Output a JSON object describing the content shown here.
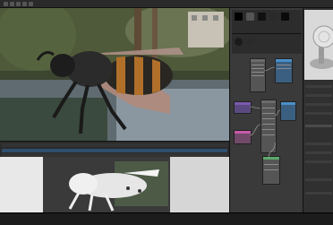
{
  "window": {
    "title": ""
  },
  "viewport": {
    "subject": "bee-model",
    "colors": {
      "bee_body": "#222222",
      "bee_stripe": "#b0702a",
      "wing": "#b08a7a",
      "background_tree": "#4d5838",
      "water": "#6f7f8d"
    }
  },
  "timeline": {
    "frame_label": "",
    "tracks": [
      "",
      "",
      ""
    ]
  },
  "bottom_viewport": {
    "subject": "bee-clay-render"
  },
  "node_editor": {
    "material_swatches": [
      "#000000",
      "#5a5a5a",
      "#111111",
      "#2a2a2a",
      "#0a0a0a",
      "#cccccc"
    ],
    "nodes": [
      {
        "header_color": "#6b6b6b",
        "accent": "#4a90c8"
      },
      {
        "header_color": "#6b6b6b",
        "accent": "#7a5ab0"
      },
      {
        "header_color": "#6b6b6b",
        "accent": "#c85aa8"
      },
      {
        "header_color": "#6b6b6b",
        "accent": "#4a90c8"
      },
      {
        "header_color": "#6b6b6b",
        "accent": "#5aa86b"
      },
      {
        "header_color": "#6b6b6b",
        "accent": "#4a90c8"
      }
    ]
  },
  "properties": {
    "preview_subject": "material-sphere-on-stand",
    "rows": [
      "",
      "",
      "",
      "",
      "",
      "",
      "",
      "",
      "",
      "",
      "",
      ""
    ]
  },
  "colors": {
    "panel_bg": "#3a3a3a",
    "dark_bg": "#222222",
    "accent_orange": "#d08020",
    "accent_blue": "#3a7ac8"
  }
}
